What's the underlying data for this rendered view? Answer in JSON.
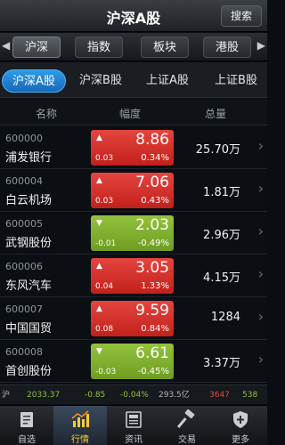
{
  "header": {
    "title": "沪深A股",
    "search_label": "搜索"
  },
  "market_tabs": {
    "items": [
      "沪深",
      "指数",
      "板块",
      "港股"
    ],
    "active": 0,
    "left_arrow": "◀",
    "right_arrow": "▶"
  },
  "sub_tabs": {
    "items": [
      "沪深A股",
      "沪深B股",
      "上证A股",
      "上证B股"
    ],
    "active": 0
  },
  "columns": {
    "name": "名称",
    "change": "幅度",
    "volume": "总量"
  },
  "rows": [
    {
      "code": "600000",
      "name": "浦发银行",
      "price": "8.86",
      "change": "0.03",
      "percent": "0.34%",
      "volume": "25.70万",
      "direction": "up"
    },
    {
      "code": "600004",
      "name": "白云机场",
      "price": "7.06",
      "change": "0.03",
      "percent": "0.43%",
      "volume": "1.81万",
      "direction": "up"
    },
    {
      "code": "600005",
      "name": "武钢股份",
      "price": "2.03",
      "change": "-0.01",
      "percent": "-0.49%",
      "volume": "2.96万",
      "direction": "down"
    },
    {
      "code": "600006",
      "name": "东风汽车",
      "price": "3.05",
      "change": "0.04",
      "percent": "1.33%",
      "volume": "4.15万",
      "direction": "up"
    },
    {
      "code": "600007",
      "name": "中国国贸",
      "price": "9.59",
      "change": "0.08",
      "percent": "0.84%",
      "volume": "1284",
      "direction": "up"
    },
    {
      "code": "600008",
      "name": "首创股份",
      "price": "6.61",
      "change": "-0.03",
      "percent": "-0.45%",
      "volume": "3.37万",
      "direction": "down"
    }
  ],
  "ticker": {
    "label": "沪",
    "index": "2033.37",
    "change": "-0.85",
    "percent": "-0.04%",
    "amount": "293.5亿",
    "up_count": "3647",
    "down_count": "538"
  },
  "bottom_nav": {
    "items": [
      {
        "label": "自选",
        "icon": "favorites-icon"
      },
      {
        "label": "行情",
        "icon": "market-chart-icon"
      },
      {
        "label": "资讯",
        "icon": "news-icon"
      },
      {
        "label": "交易",
        "icon": "trade-hammer-icon"
      },
      {
        "label": "更多",
        "icon": "more-shield-icon"
      }
    ],
    "active": 1
  },
  "colors": {
    "up": "#e5453f",
    "down": "#8fc23b",
    "accent": "#2d9be8",
    "active_nav_label": "#ffcc33"
  }
}
